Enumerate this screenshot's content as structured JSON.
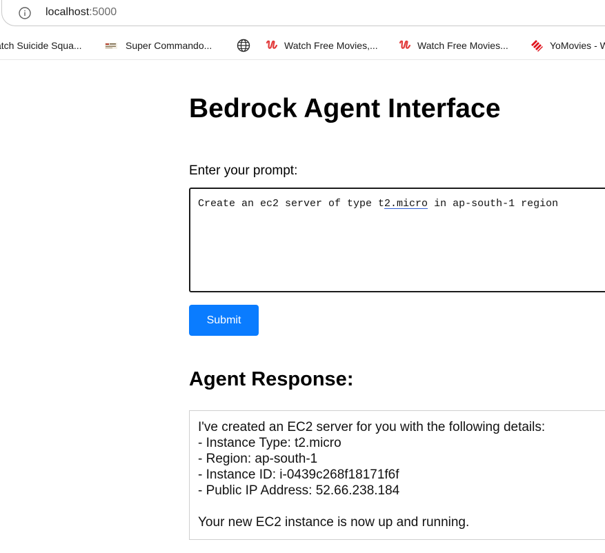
{
  "browser": {
    "url_host": "localhost",
    "url_port": ":5000",
    "bookmarks": [
      {
        "label": "atch Suicide Squa...",
        "icon": "none"
      },
      {
        "label": "Super Commando...",
        "icon": "site-thumbnail-icon"
      },
      {
        "label": "",
        "icon": "globe-icon"
      },
      {
        "label": "Watch Free Movies,...",
        "icon": "red-u-logo-icon"
      },
      {
        "label": "Watch Free Movies...",
        "icon": "red-u-logo-icon"
      },
      {
        "label": "YoMovies - W",
        "icon": "red-stripes-logo-icon"
      }
    ]
  },
  "page": {
    "title": "Bedrock Agent Interface",
    "prompt_label": "Enter your prompt:",
    "prompt_value": {
      "before": "Create an ec2 server of type t",
      "flagged": "2.micro",
      "after": " in ap-south-1 region"
    },
    "submit_label": "Submit",
    "submit_color": "#0a7cff",
    "response_heading": "Agent Response:",
    "response_lines": [
      "I've created an EC2 server for you with the following details:",
      "- Instance Type: t2.micro",
      "- Region: ap-south-1",
      "- Instance ID: i-0439c268f18171f6f",
      "- Public IP Address: 52.66.238.184"
    ],
    "response_closing": "Your new EC2 instance is now up and running."
  }
}
